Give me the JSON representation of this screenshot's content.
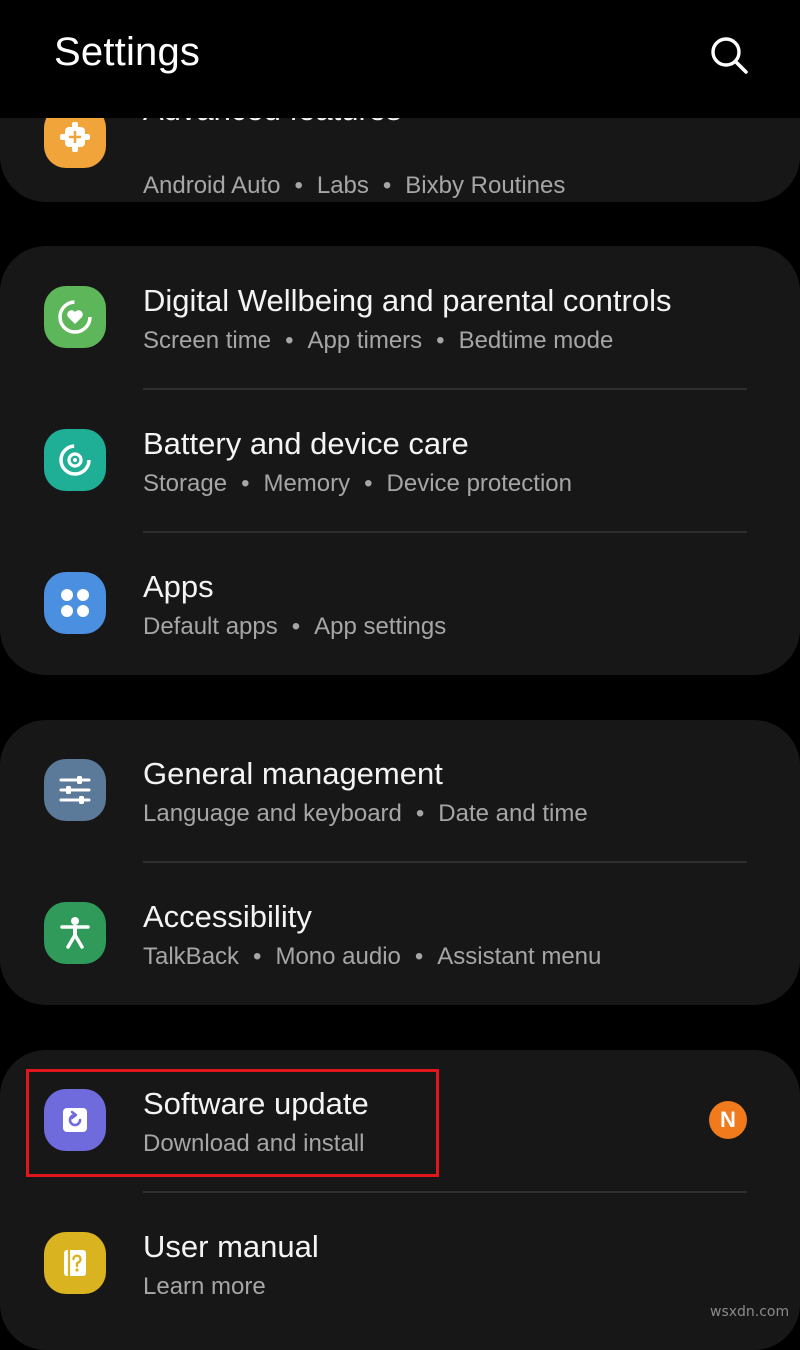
{
  "header": {
    "title": "Settings",
    "search_icon": "search-icon"
  },
  "items": {
    "advanced": {
      "title": "Advanced features",
      "subtitle": [
        "Android Auto",
        "Labs",
        "Bixby Routines"
      ],
      "icon": "puzzle-gear-icon",
      "color": "#f0a43a"
    },
    "wellbeing": {
      "title": "Digital Wellbeing and parental controls",
      "subtitle": [
        "Screen time",
        "App timers",
        "Bedtime mode"
      ],
      "icon": "wellbeing-heart-icon",
      "color": "#5db65a"
    },
    "battery": {
      "title": "Battery and device care",
      "subtitle": [
        "Storage",
        "Memory",
        "Device protection"
      ],
      "icon": "device-care-icon",
      "color": "#1fae96"
    },
    "apps": {
      "title": "Apps",
      "subtitle": [
        "Default apps",
        "App settings"
      ],
      "icon": "apps-grid-icon",
      "color": "#4a8fe0"
    },
    "general": {
      "title": "General management",
      "subtitle": [
        "Language and keyboard",
        "Date and time"
      ],
      "icon": "sliders-icon",
      "color": "#5b7a99"
    },
    "accessibility": {
      "title": "Accessibility",
      "subtitle": [
        "TalkBack",
        "Mono audio",
        "Assistant menu"
      ],
      "icon": "accessibility-person-icon",
      "color": "#2f9a5a"
    },
    "software": {
      "title": "Software update",
      "subtitle": [
        "Download and install"
      ],
      "icon": "software-update-icon",
      "color": "#6f6bdc",
      "badge": "N",
      "badge_color": "#f07a1c",
      "highlight_color": "#e1161c"
    },
    "manual": {
      "title": "User manual",
      "subtitle": [
        "Learn more"
      ],
      "icon": "user-manual-icon",
      "color": "#d9b320"
    }
  },
  "watermark": "wsxdn.com"
}
